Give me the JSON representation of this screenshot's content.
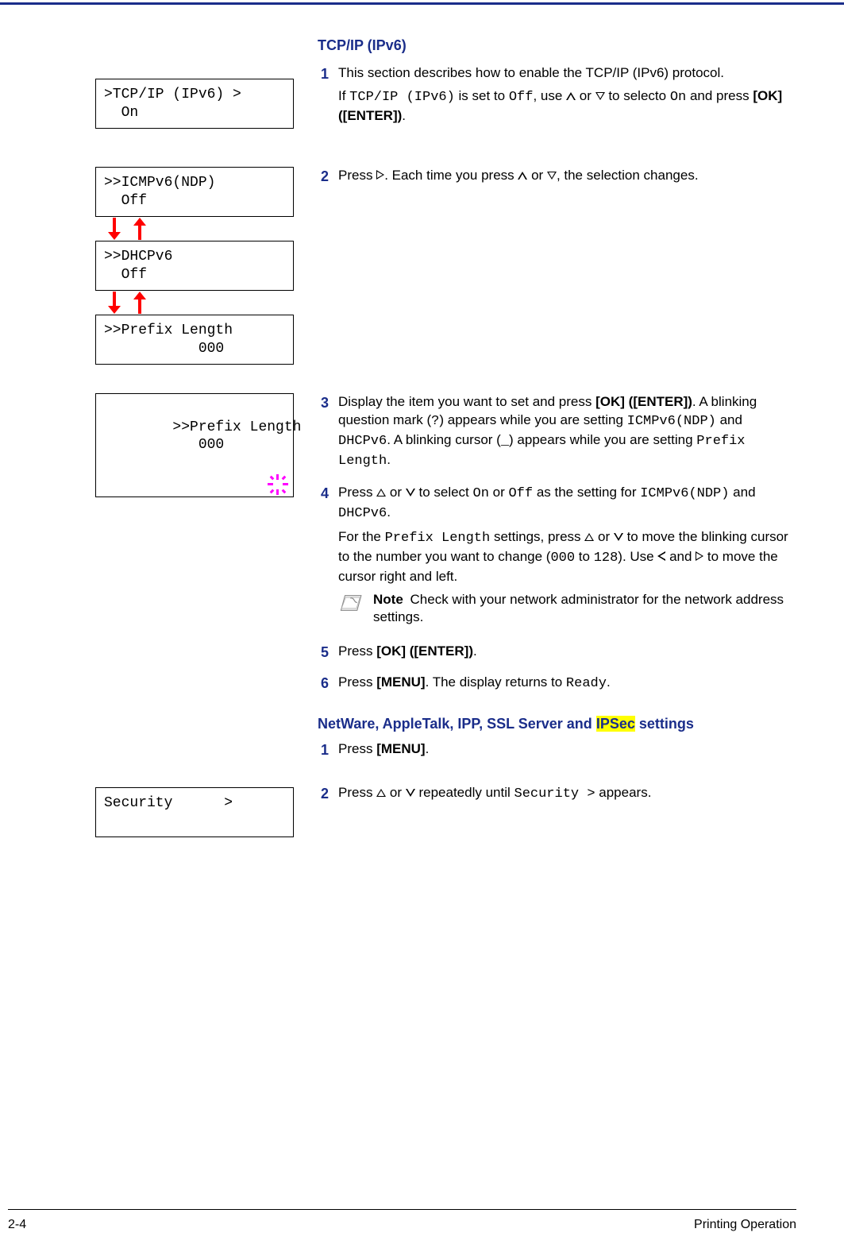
{
  "section1": {
    "heading": "TCP/IP (IPv6)",
    "step1_line1": "This section describes how to enable the TCP/IP (IPv6) protocol.",
    "step1_line2a": "If ",
    "step1_line2_code1": "TCP/IP (IPv6)",
    "step1_line2b": " is set to ",
    "step1_line2_code2": "Off",
    "step1_line2c": ", use ",
    "step1_line2d": " or ",
    "step1_line2e": " to selecto ",
    "step1_line2_code3": "On",
    "step1_line2f": " and press ",
    "step1_line2_bold": "[OK] ([ENTER])",
    "step1_line2g": ".",
    "step2a": "Press ",
    "step2b": ".  Each time you press ",
    "step2c": " or ",
    "step2d": ", the selection changes.",
    "step3a": "Display the item you want to set and press ",
    "step3_bold1": "[OK] ([ENTER])",
    "step3b": ". A blinking question mark (",
    "step3_code1": "?",
    "step3c": ") appears while you are setting ",
    "step3_code2": "ICMPv6(NDP)",
    "step3d": " and ",
    "step3_code3": "DHCPv6",
    "step3e": ". A blinking cursor (",
    "step3_code4": "_",
    "step3f": ") appears while you are setting ",
    "step3_code5": "Prefix Length",
    "step3g": ".",
    "step4a": "Press ",
    "step4b": " or ",
    "step4c": " to select ",
    "step4_code1": "On",
    "step4d": " or ",
    "step4_code2": "Off",
    "step4e": " as the setting for ",
    "step4_code3": "ICMPv6(NDP)",
    "step4f": " and ",
    "step4_code4": "DHCPv6",
    "step4g": ".",
    "step4_p2a": "For the ",
    "step4_p2_code1": "Prefix Length",
    "step4_p2b": " settings, press ",
    "step4_p2c": " or ",
    "step4_p2d": " to move the blinking cursor to the number you want to change (",
    "step4_p2_code2": "000",
    "step4_p2e": " to ",
    "step4_p2_code3": "128",
    "step4_p2f": "). Use ",
    "step4_p2g": " and ",
    "step4_p2h": " to move the cursor right and left.",
    "note_label": "Note",
    "note_text": "  Check with your network administrator for the network address settings.",
    "step5a": "Press ",
    "step5_bold": "[OK] ([ENTER])",
    "step5b": ".",
    "step6a": "Press ",
    "step6_bold": "[MENU]",
    "step6b": ".  The display returns to ",
    "step6_code": "Ready",
    "step6c": "."
  },
  "section2": {
    "heading_a": "NetWare, AppleTalk, IPP, SSL Server and ",
    "heading_hl": "IPSec",
    "heading_b": " settings",
    "step1a": "Press ",
    "step1_bold": "[MENU]",
    "step1b": ".",
    "step2a": "Press ",
    "step2b": " or ",
    "step2c": " repeatedly until ",
    "step2_code": "Security >",
    "step2d": " appears."
  },
  "lcds": {
    "tcpip": ">TCP/IP (IPv6) >\n  On",
    "icmp": ">>ICMPv6(NDP)\n  Off",
    "dhcp": ">>DHCPv6\n  Off",
    "prefix1": ">>Prefix Length\n           000",
    "prefix2": ">>Prefix Length\n           000",
    "security": "Security      >\n "
  },
  "nums": {
    "n1": "1",
    "n2": "2",
    "n3": "3",
    "n4": "4",
    "n5": "5",
    "n6": "6"
  },
  "footer": {
    "left": "2-4",
    "right": "Printing Operation"
  }
}
